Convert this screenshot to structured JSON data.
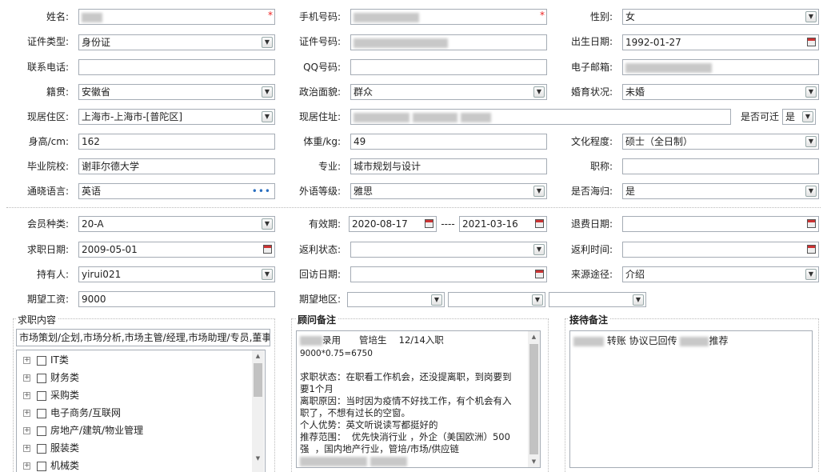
{
  "form": {
    "name_label": "姓名:",
    "phone_label": "手机号码:",
    "gender_label": "性别:",
    "gender": "女",
    "idtype_label": "证件类型:",
    "idtype": "身份证",
    "idno_label": "证件号码:",
    "birth_label": "出生日期:",
    "birth": "1992-01-27",
    "tel_label": "联系电话:",
    "qq_label": "QQ号码:",
    "email_label": "电子邮箱:",
    "native_label": "籍贯:",
    "native": "安徽省",
    "political_label": "政治面貌:",
    "political": "群众",
    "marital_label": "婚育状况:",
    "marital": "未婚",
    "region_label": "现居住区:",
    "region": "上海市-上海市-[普陀区]",
    "address_label": "现居住址:",
    "relocate_label": "是否可迁",
    "relocate": "是",
    "height_label": "身高/cm:",
    "height": "162",
    "weight_label": "体重/kg:",
    "weight": "49",
    "edu_label": "文化程度:",
    "edu": "硕士（全日制）",
    "school_label": "毕业院校:",
    "school": "谢菲尔德大学",
    "major_label": "专业:",
    "major": "城市规划与设计",
    "title_label": "职称:",
    "lang_label": "通晓语言:",
    "lang": "英语",
    "lang_level_label": "外语等级:",
    "lang_level": "雅思",
    "overseas_label": "是否海归:",
    "overseas": "是"
  },
  "member": {
    "type_label": "会员种类:",
    "type": "20-A",
    "valid_label": "有效期:",
    "valid_from": "2020-08-17",
    "valid_sep": "----",
    "valid_to": "2021-03-16",
    "refund_label": "退费日期:",
    "jobdate_label": "求职日期:",
    "jobdate": "2009-05-01",
    "rebate_label": "返利状态:",
    "rebate_time_label": "返利时间:",
    "holder_label": "持有人:",
    "holder": "yirui021",
    "visit_label": "回访日期:",
    "source_label": "来源途径:",
    "source": "介绍",
    "salary_label": "期望工资:",
    "salary": "9000",
    "area_label": "期望地区:"
  },
  "job_panel": {
    "title": "求职内容",
    "summary": "市场策划/企划,市场分析,市场主管/经理,市场助理/专员,董事",
    "categories": [
      "IT类",
      "财务类",
      "采购类",
      "电子商务/互联网",
      "房地产/建筑/物业管理",
      "服装类",
      "机械类"
    ]
  },
  "advisor_panel": {
    "title": "顾问备注",
    "line1_tail": "录用　　管培生　 12/14入职",
    "line2": "9000*0.75=6750",
    "body": "求职状态：在职看工作机会，还没提离职，到岗要到\n要1个月\n离职原因：当时因为疫情不好找工作，有个机会有入\n职了，不想有过长的空窗。\n个人优势：英文听说读写都挺好的\n推荐范围：  优先快消行业 ，外企（美国欧洲）500\n强  ，国内地产行业，管培/市场/供应链"
  },
  "reception_panel": {
    "title": "接待备注",
    "text1": "转账 协议已回传",
    "text2": "推荐"
  },
  "colors": {
    "required": "#ee2222",
    "border": "#a5acb5",
    "link_dots": "#2a6fc0"
  },
  "icons": [
    "dropdown-arrow-icon",
    "calendar-icon",
    "ellipsis-icon",
    "expand-plus-icon",
    "checkbox-icon"
  ]
}
